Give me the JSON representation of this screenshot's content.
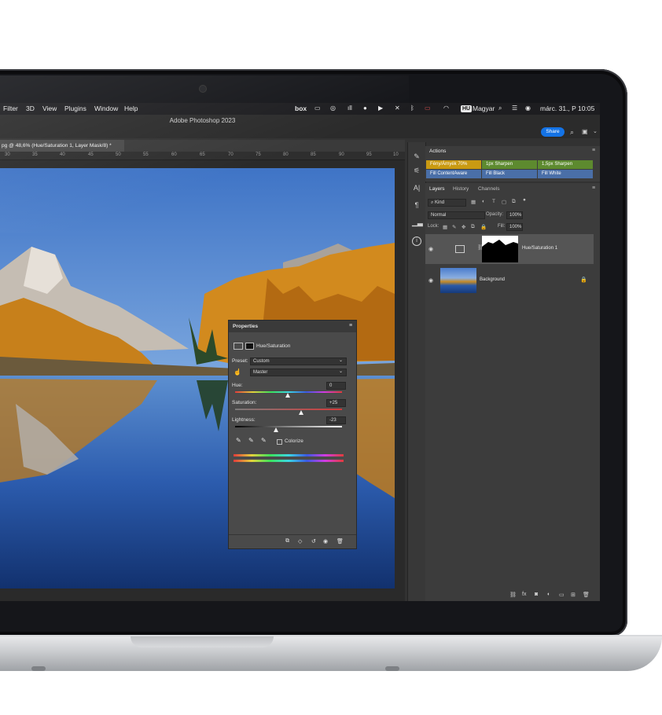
{
  "menubar": {
    "items": [
      "Filter",
      "3D",
      "View",
      "Plugins",
      "Window",
      "Help"
    ],
    "status_box": "box",
    "language_badge": "HU",
    "language_name": "Magyar",
    "datetime": "márc. 31., P  10:05"
  },
  "app": {
    "title": "Adobe Photoshop 2023",
    "share_label": "Share",
    "document_tab": "pg @ 48,6% (Hue/Saturation 1, Layer Mask/8) *"
  },
  "ruler": {
    "ticks": [
      "30",
      "35",
      "40",
      "45",
      "50",
      "55",
      "60",
      "65",
      "70",
      "75",
      "80",
      "85",
      "90",
      "95",
      "10"
    ]
  },
  "properties": {
    "title": "Properties",
    "adjustment_name": "Hue/Saturation",
    "preset_label": "Preset:",
    "preset_value": "Custom",
    "channel_value": "Master",
    "hue_label": "Hue:",
    "hue_value": "0",
    "saturation_label": "Saturation:",
    "saturation_value": "+25",
    "lightness_label": "Lightness:",
    "lightness_value": "-23",
    "colorize_label": "Colorize"
  },
  "actions": {
    "title": "Actions",
    "buttons": [
      {
        "label": "Fény/Árnyék 70%",
        "color": "#c99a12"
      },
      {
        "label": "1px Sharpen",
        "color": "#5d8a2f"
      },
      {
        "label": "1,5px Sharpen",
        "color": "#5d8a2f"
      },
      {
        "label": "Fill ContentAware",
        "color": "#4a6fa8"
      },
      {
        "label": "Fill Black",
        "color": "#4a6fa8"
      },
      {
        "label": "Fill White",
        "color": "#4a6fa8"
      }
    ]
  },
  "layers_panel": {
    "tabs": [
      "Layers",
      "History",
      "Channels"
    ],
    "filter_label": "Kind",
    "blend_mode": "Normal",
    "opacity_label": "Opacity:",
    "opacity_value": "100%",
    "lock_label": "Lock:",
    "fill_label": "Fill:",
    "fill_value": "100%",
    "layers": [
      {
        "name": "Hue/Saturation 1"
      },
      {
        "name": "Background"
      }
    ]
  },
  "colors": {
    "ui_dark": "#323232",
    "panel": "#3c3c3c",
    "accent_blue": "#1473e6"
  }
}
